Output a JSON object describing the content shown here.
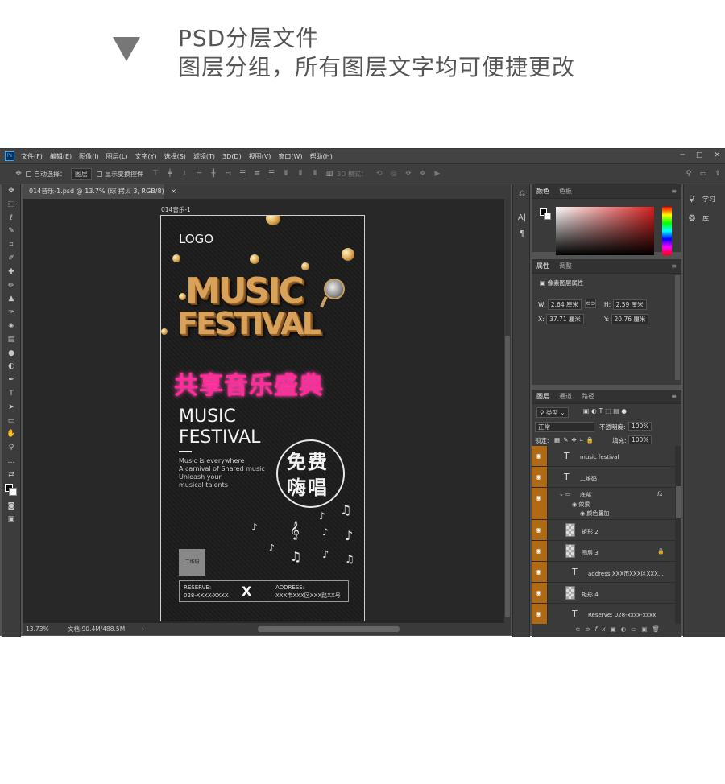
{
  "header": {
    "line1": "PSD分层文件",
    "line2": "图层分组，所有图层文字均可便捷更改"
  },
  "menubar": {
    "logo": "Ps",
    "items": [
      "文件(F)",
      "编辑(E)",
      "图像(I)",
      "图层(L)",
      "文字(Y)",
      "选择(S)",
      "滤镜(T)",
      "3D(D)",
      "视图(V)",
      "窗口(W)",
      "帮助(H)"
    ],
    "min": "─",
    "max": "□",
    "close": "✕"
  },
  "options": {
    "auto_select": "自动选择：",
    "layer_select": "图层",
    "transform": "显示变换控件",
    "mode3d": "3D 模式："
  },
  "document": {
    "tab": "014音乐-1.psd @ 13.7% (球 拷贝 3, RGB/8)",
    "tab_close": "×",
    "label": "014音乐-1"
  },
  "status": {
    "zoom": "13.73%",
    "doc": "文档:90.4M/488.5M",
    "arrow": "›"
  },
  "poster": {
    "logo": "LOGO",
    "music3d": "MUSIC",
    "festival3d": "FESTIVAL",
    "slogan": "共享音乐盛典",
    "title1": "MUSIC",
    "title2": "FESTIVAL",
    "tagline": [
      "Music is everywhere",
      "A carnival of Shared music",
      "Unleash your",
      "musical talents"
    ],
    "free1": "免费",
    "free2": "嗨唱",
    "qr": "二维码",
    "reserve_label": "RESERVE:",
    "reserve_value": "028-XXXX-XXXX",
    "x": "X",
    "address_label": "ADDRESS:",
    "address_value": "XXX市XXX区XXX路XX号"
  },
  "color_panel": {
    "tabs": [
      "颜色",
      "色板"
    ],
    "accent_red": "#d62020"
  },
  "properties": {
    "tabs": [
      "属性",
      "调整"
    ],
    "kind": "像素图层属性",
    "w_label": "W:",
    "w": "2.64 厘米",
    "h_label": "H:",
    "h": "2.59 厘米",
    "x_label": "X:",
    "x": "37.71 厘米",
    "y_label": "Y:",
    "y": "20.76 厘米"
  },
  "layers": {
    "tabs": [
      "图层",
      "通道",
      "路径"
    ],
    "filter": "类型",
    "blend": "正常",
    "opacity_label": "不透明度:",
    "opacity": "100%",
    "lock_label": "锁定:",
    "fill_label": "填充:",
    "fill": "100%",
    "items": [
      "music festival",
      "二维码",
      "底部",
      "效果",
      "颜色叠加",
      "矩形 2",
      "图层 3",
      "address:XXX市XXX区XXX...",
      "矩形 4",
      "Reserve: 028-xxxx-xxxx"
    ],
    "fx": "fx"
  },
  "right": {
    "learn": "学习",
    "library": "库"
  }
}
